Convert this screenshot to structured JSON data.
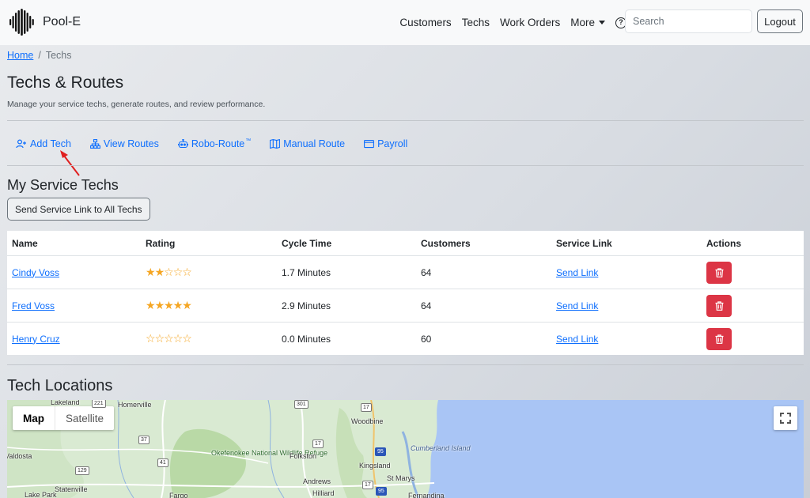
{
  "navbar": {
    "brand": "Pool-E",
    "links": [
      "Customers",
      "Techs",
      "Work Orders",
      "More"
    ],
    "search_placeholder": "Search",
    "logout_label": "Logout"
  },
  "breadcrumb": {
    "home": "Home",
    "separator": "/",
    "current": "Techs"
  },
  "header": {
    "title": "Techs & Routes",
    "subtitle": "Manage your service techs, generate routes, and review performance."
  },
  "actions": {
    "add_tech": "Add Tech",
    "view_routes": "View Routes",
    "robo_route": "Robo-Route",
    "robo_route_tm": "™",
    "manual_route": "Manual Route",
    "payroll": "Payroll"
  },
  "techs_section": {
    "title": "My Service Techs",
    "send_all_label": "Send Service Link to All Techs",
    "columns": [
      "Name",
      "Rating",
      "Cycle Time",
      "Customers",
      "Service Link",
      "Actions"
    ],
    "rows": [
      {
        "name": "Cindy Voss",
        "rating": 2,
        "cycle_time": "1.7 Minutes",
        "customers": "64",
        "link": "Send Link"
      },
      {
        "name": "Fred Voss",
        "rating": 5,
        "cycle_time": "2.9 Minutes",
        "customers": "64",
        "link": "Send Link"
      },
      {
        "name": "Henry Cruz",
        "rating": 0,
        "cycle_time": "0.0 Minutes",
        "customers": "60",
        "link": "Send Link"
      }
    ]
  },
  "map_section": {
    "title": "Tech Locations",
    "map_type": {
      "map": "Map",
      "satellite": "Satellite",
      "selected": "Map"
    },
    "places": [
      "Lakeland",
      "Homerville",
      "Woodbine",
      "Valdosta",
      "Okefenokee National Wildlife Refuge",
      "Folkston",
      "Kingsland",
      "Cumberland Island",
      "Andrews",
      "St Marys",
      "Statenville",
      "Lake Park",
      "Fargo",
      "Hilliard",
      "Fernandina"
    ],
    "road_shields": [
      "221",
      "301",
      "17",
      "17",
      "37",
      "41",
      "95",
      "129",
      "95",
      "17"
    ]
  },
  "colors": {
    "primary": "#0d6efd",
    "danger": "#dc3545",
    "star": "#f5a623",
    "navbar_bg": "#f8f9fa",
    "map_water": "#a9c5f5",
    "map_land": "#d9ead2"
  }
}
